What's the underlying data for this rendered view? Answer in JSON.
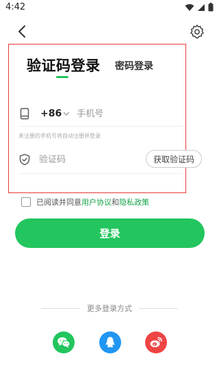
{
  "status_bar": {
    "time": "4:42"
  },
  "tabs": {
    "sms_login": "验证码登录",
    "password_login": "密码登录"
  },
  "phone": {
    "country_code": "+86",
    "placeholder": "手机号"
  },
  "hint": "未注册的手机号将自动注册并登录",
  "verify": {
    "placeholder": "验证码",
    "get_code_label": "获取验证码"
  },
  "agreement": {
    "prefix": "已阅读并同意",
    "user_agreement": "用户协议",
    "and": "和",
    "privacy_policy": "隐私政策"
  },
  "login_label": "登录",
  "more_login": "更多登录方式",
  "colors": {
    "accent": "#22c55e",
    "wechat": "#22c55e",
    "qq": "#2196f3",
    "weibo": "#ef4444",
    "highlight": "#e53935"
  },
  "icons": [
    "back-icon",
    "gear-icon",
    "phone-icon",
    "shield-icon",
    "wechat-icon",
    "qq-icon",
    "weibo-icon"
  ]
}
